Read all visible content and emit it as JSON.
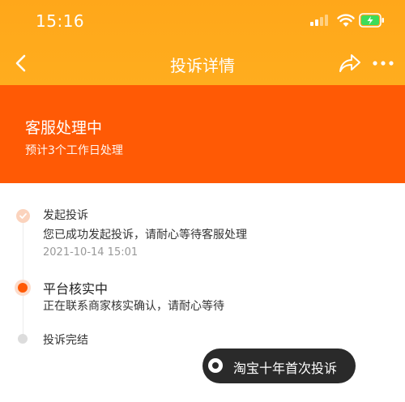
{
  "status_bar": {
    "time": "15:16"
  },
  "nav": {
    "title": "投诉详情"
  },
  "banner": {
    "title": "客服处理中",
    "subtitle": "预计3个工作日处理"
  },
  "steps": [
    {
      "title": "发起投诉",
      "desc": "您已成功发起投诉，请耐心等待客服处理",
      "time": "2021-10-14 15:01",
      "state": "done"
    },
    {
      "title": "平台核实中",
      "desc": "正在联系商家核实确认，请耐心等待",
      "state": "active"
    },
    {
      "title": "投诉完结",
      "state": "pending"
    }
  ],
  "floating_tag": {
    "label": "淘宝十年首次投诉"
  },
  "colors": {
    "header": "#ffa71a",
    "banner": "#ff5a05",
    "accent": "#ff5a05"
  }
}
